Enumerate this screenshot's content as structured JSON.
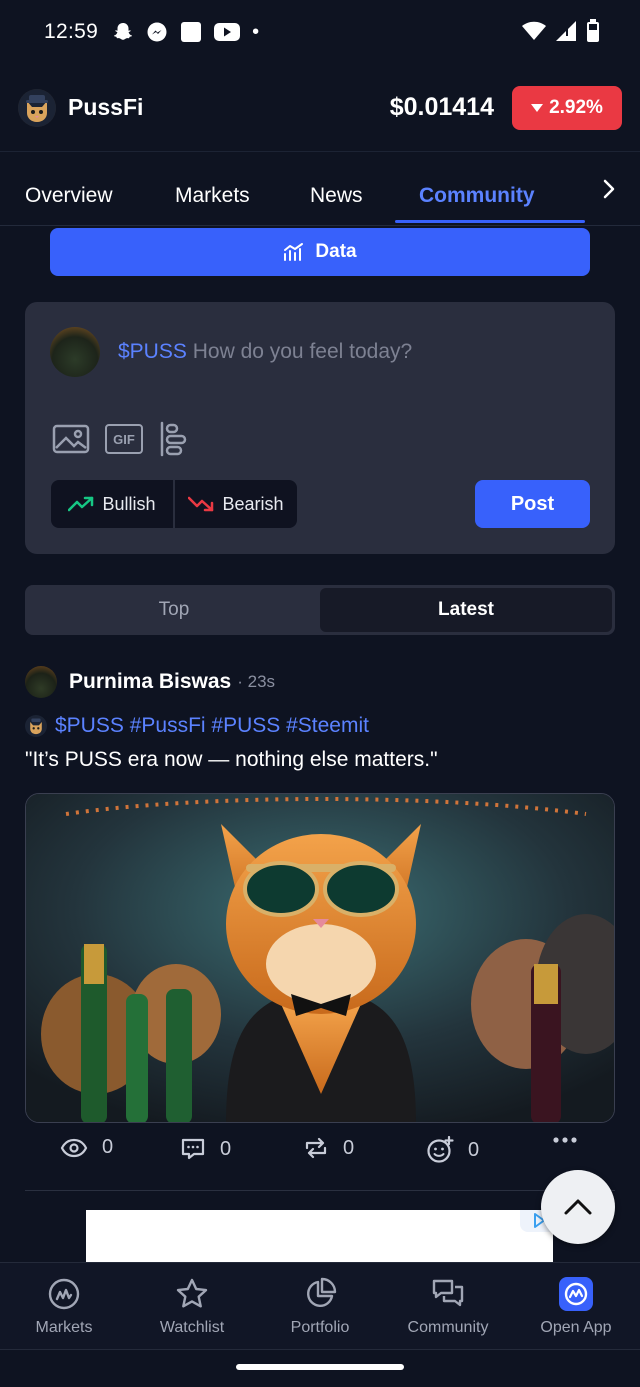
{
  "statusbar": {
    "time": "12:59",
    "dot": "•"
  },
  "header": {
    "coin_name": "PussFi",
    "price": "$0.01414",
    "change": "2.92%"
  },
  "tabs": [
    {
      "label": "Overview"
    },
    {
      "label": "Markets"
    },
    {
      "label": "News"
    },
    {
      "label": "Community"
    }
  ],
  "data_button": {
    "label": "Data"
  },
  "compose": {
    "ticker": "$PUSS",
    "placeholder": "How do you feel today?",
    "bullish_label": "Bullish",
    "bearish_label": "Bearish",
    "post_label": "Post",
    "gif_label": "GIF"
  },
  "sort": {
    "top_label": "Top",
    "latest_label": "Latest"
  },
  "post": {
    "author": "Purnima Biswas",
    "time": "· 23s",
    "tags": "$PUSS #PussFi #PUSS #Steemit",
    "text": "\"It’s PUSS era now — nothing else matters.\"",
    "views": "0",
    "comments": "0",
    "reposts": "0",
    "reactions": "0"
  },
  "bottom_nav": [
    {
      "label": "Markets"
    },
    {
      "label": "Watchlist"
    },
    {
      "label": "Portfolio"
    },
    {
      "label": "Community"
    },
    {
      "label": "Open App"
    }
  ],
  "colors": {
    "accent": "#3861fb",
    "negative": "#ea3943",
    "positive": "#16c784",
    "background": "#0e1321"
  }
}
